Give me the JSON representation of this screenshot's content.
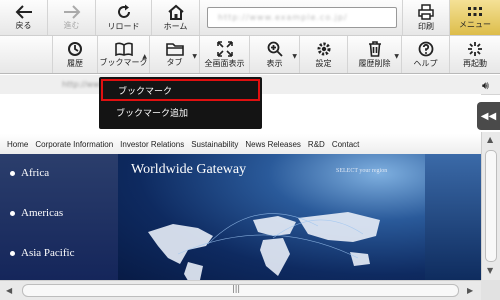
{
  "toolbar_top": {
    "back": {
      "label": "戻る",
      "icon": "back-arrow-icon"
    },
    "forward": {
      "label": "進む",
      "icon": "forward-arrow-icon",
      "disabled": true
    },
    "reload": {
      "label": "リロード",
      "icon": "reload-icon"
    },
    "home": {
      "label": "ホーム",
      "icon": "home-icon"
    },
    "address_url": "http://www.example.co.jp/",
    "print": {
      "label": "印刷",
      "icon": "print-icon"
    },
    "menu": {
      "label": "メニュー",
      "icon": "grid-icon"
    }
  },
  "toolbar_bottom": {
    "history": {
      "label": "履歴",
      "icon": "history-icon"
    },
    "bookmark": {
      "label": "ブックマーク",
      "icon": "book-icon"
    },
    "tab": {
      "label": "タブ",
      "icon": "folder-icon"
    },
    "fullscreen": {
      "label": "全画面表示",
      "icon": "fullscreen-icon"
    },
    "view": {
      "label": "表示",
      "icon": "zoom-icon"
    },
    "settings": {
      "label": "設定",
      "icon": "gear-icon"
    },
    "clear_history": {
      "label": "履歴削除",
      "icon": "trash-icon"
    },
    "help": {
      "label": "ヘルプ",
      "icon": "help-icon"
    },
    "restart": {
      "label": "再起動",
      "icon": "restart-icon"
    }
  },
  "status_text": "http://www.example.co.jp/",
  "dropdown": {
    "items": [
      {
        "label": "ブックマーク",
        "highlighted": true
      },
      {
        "label": "ブックマーク追加"
      }
    ]
  },
  "webpage": {
    "nav": [
      "Home",
      "Corporate Information",
      "Investor Relations",
      "Sustainability",
      "News Releases",
      "R&D",
      "Contact"
    ],
    "regions": [
      "Africa",
      "Americas",
      "Asia Pacific"
    ],
    "banner_title": "Worldwide Gateway",
    "banner_select": "SELECT your region"
  },
  "colors": {
    "menu_button": "#e6c65c",
    "dropdown_bg": "#141414",
    "highlight_border": "#e01010",
    "hero_bg": "#0a1c46"
  }
}
